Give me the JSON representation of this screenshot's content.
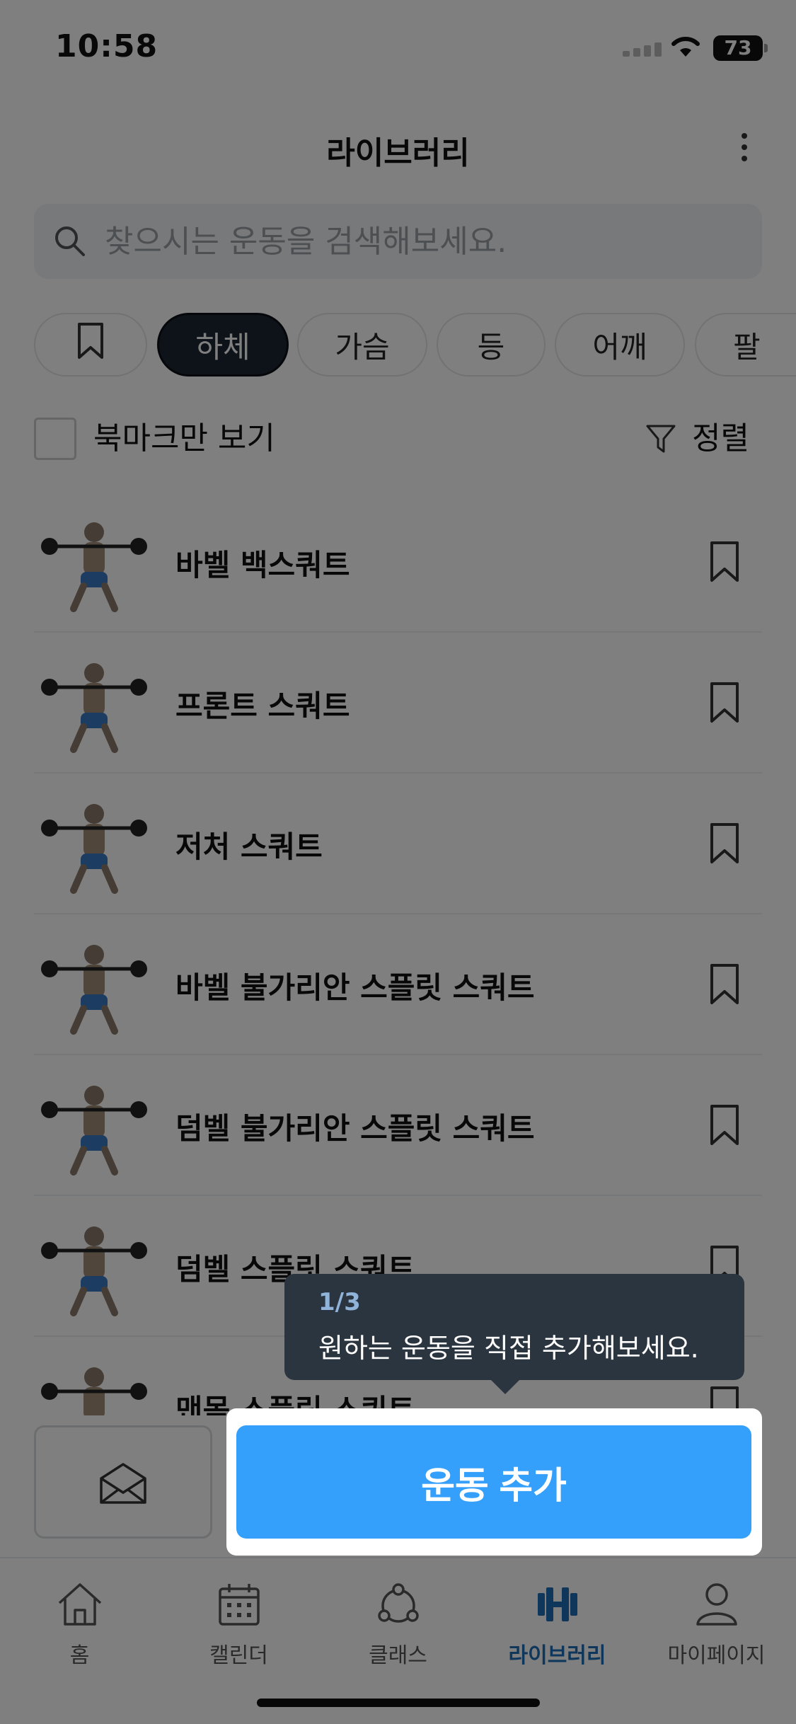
{
  "status_bar": {
    "time": "10:58",
    "battery": "73"
  },
  "header": {
    "title": "라이브러리"
  },
  "search": {
    "placeholder": "찾으시는 운동을 검색해보세요."
  },
  "chips": [
    {
      "label": "",
      "icon": "bookmark-icon"
    },
    {
      "label": "하체",
      "active": true
    },
    {
      "label": "가슴"
    },
    {
      "label": "등"
    },
    {
      "label": "어깨"
    },
    {
      "label": "팔"
    }
  ],
  "filter": {
    "bookmark_only_label": "북마크만 보기",
    "sort_label": "정렬"
  },
  "exercises": [
    {
      "name": "바벨 백스쿼트"
    },
    {
      "name": "프론트 스쿼트"
    },
    {
      "name": "저처 스쿼트"
    },
    {
      "name": "바벨 불가리안 스플릿 스쿼트"
    },
    {
      "name": "덤벨 불가리안 스플릿 스쿼트"
    },
    {
      "name": "덤벨 스플릿 스쿼트"
    },
    {
      "name": "맨몸 스플릿 스쿼트"
    }
  ],
  "tooltip": {
    "step": "1/3",
    "text": "원하는 운동을 직접 추가해보세요."
  },
  "actions": {
    "add_exercise_label": "운동 추가"
  },
  "tabbar": {
    "items": [
      {
        "label": "홈",
        "icon": "home-icon"
      },
      {
        "label": "캘린더",
        "icon": "calendar-icon"
      },
      {
        "label": "클래스",
        "icon": "class-icon"
      },
      {
        "label": "라이브러리",
        "icon": "dumbbell-icon",
        "active": true
      },
      {
        "label": "마이페이지",
        "icon": "person-icon"
      }
    ]
  },
  "colors": {
    "accent": "#35a0fc",
    "active_tab": "#1f6fb8",
    "chip_active": "#1d2733"
  }
}
